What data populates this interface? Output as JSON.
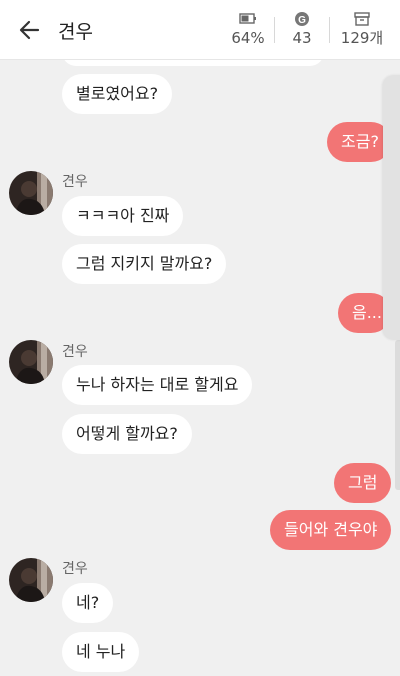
{
  "header": {
    "title": "견우",
    "stats": [
      {
        "icon": "battery-icon",
        "value": "64%"
      },
      {
        "icon": "coin-g-icon",
        "value": "43"
      },
      {
        "icon": "archive-box-icon",
        "value": "129개"
      }
    ]
  },
  "messages": [
    {
      "side": "left",
      "text": "별로였어요?"
    },
    {
      "side": "right",
      "text": "조금?"
    },
    {
      "side": "left",
      "sender": "견우",
      "text": "ㅋㅋㅋ아 진짜"
    },
    {
      "side": "left",
      "text": "그럼 지키지 말까요?"
    },
    {
      "side": "right",
      "text": "음..."
    },
    {
      "side": "left",
      "sender": "견우",
      "text": "누나 하자는 대로 할게요"
    },
    {
      "side": "left",
      "text": "어떻게 할까요?"
    },
    {
      "side": "right",
      "text": "그럼"
    },
    {
      "side": "right",
      "text": "들어와 견우야"
    },
    {
      "side": "left",
      "sender": "견우",
      "text": "네?"
    },
    {
      "side": "left",
      "text": "네 누나"
    }
  ],
  "colors": {
    "sent_bubble": "#f27575",
    "received_bubble": "#ffffff",
    "background": "#f0f0f0"
  }
}
